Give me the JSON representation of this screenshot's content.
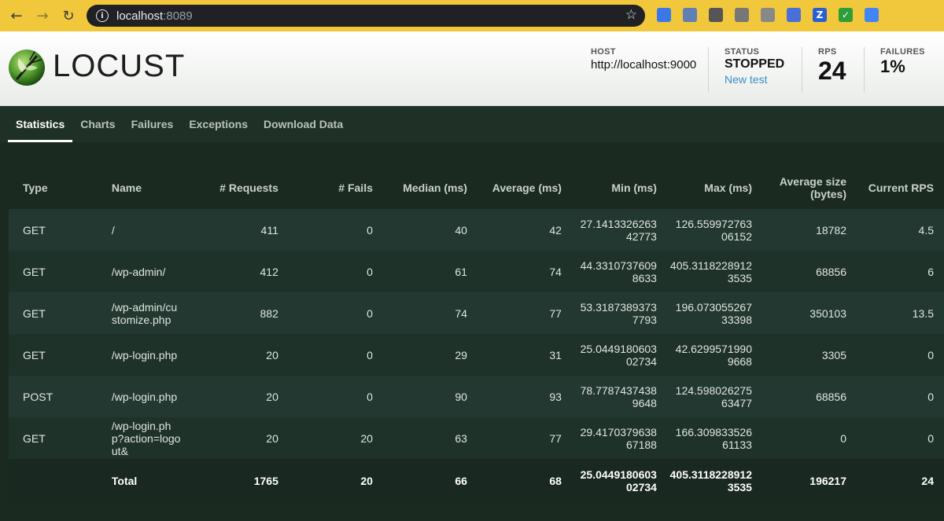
{
  "browser": {
    "url_host": "localhost",
    "url_port": ":8089",
    "extensions": [
      {
        "icon": "chat-icon",
        "color": "#3b78e7"
      },
      {
        "icon": "swirl-icon",
        "color": "#5f7fb5"
      },
      {
        "icon": "bulb-icon",
        "color": "#555555"
      },
      {
        "icon": "media-icon",
        "color": "#777777"
      },
      {
        "icon": "octocat-icon",
        "color": "#888888"
      },
      {
        "icon": "person-icon",
        "color": "#4a6fd6"
      },
      {
        "icon": "z-icon",
        "glyph": "Z",
        "color": "#2b5fd1"
      },
      {
        "icon": "check-icon",
        "glyph": "✓",
        "color": "#2e9d3a"
      },
      {
        "icon": "translate-icon",
        "color": "#4285f4"
      }
    ]
  },
  "header": {
    "logo_text": "LOCUST",
    "host_label": "HOST",
    "host_value": "http://localhost:9000",
    "status_label": "STATUS",
    "status_value": "STOPPED",
    "new_test": "New test",
    "rps_label": "RPS",
    "rps_value": "24",
    "failures_label": "FAILURES",
    "failures_value": "1%"
  },
  "tabs": [
    {
      "label": "Statistics",
      "active": true
    },
    {
      "label": "Charts"
    },
    {
      "label": "Failures"
    },
    {
      "label": "Exceptions"
    },
    {
      "label": "Download Data"
    }
  ],
  "table": {
    "columns": [
      "Type",
      "Name",
      "# Requests",
      "# Fails",
      "Median (ms)",
      "Average (ms)",
      "Min (ms)",
      "Max (ms)",
      "Average size (bytes)",
      "Current RPS"
    ],
    "rows": [
      [
        "GET",
        "/",
        "411",
        "0",
        "40",
        "42",
        "27.141332626342773",
        "126.55997276306152",
        "18782",
        "4.5"
      ],
      [
        "GET",
        "/wp-admin/",
        "412",
        "0",
        "61",
        "74",
        "44.33107376098633",
        "405.31182289123535",
        "68856",
        "6"
      ],
      [
        "GET",
        "/wp-admin/customize.php",
        "882",
        "0",
        "74",
        "77",
        "53.31873893737793",
        "196.07305526733398",
        "350103",
        "13.5"
      ],
      [
        "GET",
        "/wp-login.php",
        "20",
        "0",
        "29",
        "31",
        "25.044918060302734",
        "42.62995719909668",
        "3305",
        "0"
      ],
      [
        "POST",
        "/wp-login.php",
        "20",
        "0",
        "90",
        "93",
        "78.77874374389648",
        "124.59802627563477",
        "68856",
        "0"
      ],
      [
        "GET",
        "/wp-login.php?action=logout&",
        "20",
        "20",
        "63",
        "77",
        "29.417037963867188",
        "166.30983352661133",
        "0",
        "0"
      ]
    ],
    "total": [
      "",
      "Total",
      "1765",
      "20",
      "66",
      "68",
      "25.044918060302734",
      "405.31182289123535",
      "196217",
      "24"
    ]
  }
}
